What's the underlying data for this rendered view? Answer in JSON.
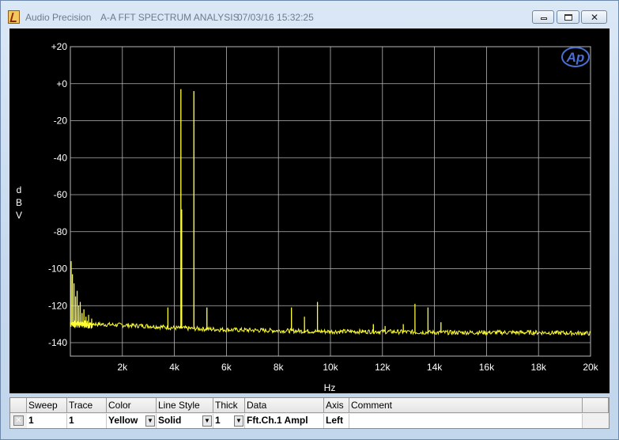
{
  "window": {
    "app_name": "Audio Precision",
    "document_title": "A-A FFT SPECTRUM ANALYSIS",
    "datetime": "07/03/16 15:32:25",
    "controls": {
      "minimize_icon": "minimize-icon",
      "maximize_icon": "restore-icon",
      "close_icon": "close-icon",
      "close_glyph": "✕"
    }
  },
  "colors": {
    "plot_bg": "#000000",
    "grid": "#b7b7b7",
    "trace": "#ffff33",
    "axis_text": "#ffffff",
    "logo": "#4a6fd0"
  },
  "logo_text": "Ap",
  "chart_data": {
    "type": "line",
    "ylabel": "d\nB\nV",
    "xlabel": "Hz",
    "ylim": [
      -150,
      20
    ],
    "xlim": [
      0,
      20000
    ],
    "y_ticks": [
      "+20",
      "+0",
      "-20",
      "-40",
      "-60",
      "-80",
      "-100",
      "-120",
      "-140"
    ],
    "y_tick_values": [
      20,
      0,
      -20,
      -40,
      -60,
      -80,
      -100,
      -120,
      -140
    ],
    "x_ticks": [
      "2k",
      "4k",
      "6k",
      "8k",
      "10k",
      "12k",
      "14k",
      "16k",
      "18k",
      "20k"
    ],
    "x_tick_values": [
      2000,
      4000,
      6000,
      8000,
      10000,
      12000,
      14000,
      16000,
      18000,
      20000
    ],
    "grid": true,
    "series": [
      {
        "color": "#ffff33",
        "noise_floor": [
          [
            0,
            -129
          ],
          [
            500,
            -129
          ],
          [
            1000,
            -130
          ],
          [
            2000,
            -130.5
          ],
          [
            3000,
            -131
          ],
          [
            4000,
            -132
          ],
          [
            6000,
            -133
          ],
          [
            8000,
            -133.5
          ],
          [
            10000,
            -134
          ],
          [
            12000,
            -134
          ],
          [
            14000,
            -134.5
          ],
          [
            16000,
            -134.5
          ],
          [
            18000,
            -134.5
          ],
          [
            20000,
            -135
          ]
        ],
        "low_freq_peaks": [
          [
            30,
            -96
          ],
          [
            80,
            -103
          ],
          [
            140,
            -108
          ],
          [
            200,
            -115
          ],
          [
            260,
            -112
          ],
          [
            320,
            -120
          ],
          [
            380,
            -118
          ],
          [
            450,
            -124
          ],
          [
            520,
            -122
          ],
          [
            600,
            -126
          ],
          [
            700,
            -125
          ],
          [
            820,
            -127
          ]
        ],
        "peaks": [
          [
            3750,
            -121
          ],
          [
            4250,
            -3
          ],
          [
            4280,
            -68
          ],
          [
            4750,
            -4
          ],
          [
            5250,
            -121
          ],
          [
            8500,
            -121
          ],
          [
            9000,
            -126
          ],
          [
            9500,
            -118
          ],
          [
            11650,
            -130
          ],
          [
            12100,
            -131
          ],
          [
            12800,
            -130
          ],
          [
            13250,
            -119
          ],
          [
            13750,
            -121
          ],
          [
            14250,
            -129
          ]
        ]
      }
    ]
  },
  "table": {
    "columns": [
      "Sweep",
      "Trace",
      "Color",
      "Line Style",
      "Thick",
      "Data",
      "Axis",
      "Comment"
    ],
    "rows": [
      {
        "checked": true,
        "sweep": "1",
        "trace": "1",
        "color": "Yellow",
        "line_style": "Solid",
        "thick": "1",
        "data": "Fft.Ch.1 Ampl",
        "axis": "Left",
        "comment": ""
      }
    ]
  }
}
